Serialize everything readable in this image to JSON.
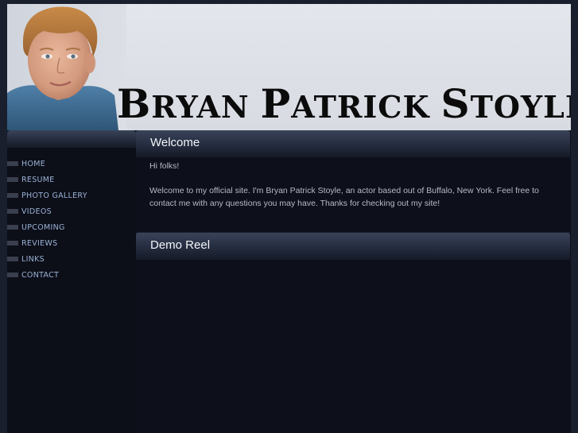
{
  "header": {
    "title_words": [
      {
        "cap": "B",
        "rest": "RYAN"
      },
      {
        "cap": "P",
        "rest": "ATRICK"
      },
      {
        "cap": "S",
        "rest": "TOYLE"
      }
    ]
  },
  "sidebar": {
    "items": [
      {
        "label": "HOME"
      },
      {
        "label": "RESUME"
      },
      {
        "label": "PHOTO GALLERY"
      },
      {
        "label": "VIDEOS"
      },
      {
        "label": "UPCOMING"
      },
      {
        "label": "REVIEWS"
      },
      {
        "label": "LINKS"
      },
      {
        "label": "CONTACT"
      }
    ]
  },
  "welcome": {
    "heading": "Welcome",
    "greeting": "Hi folks!",
    "body": "Welcome to my official site. I'm Bryan Patrick Stoyle, an actor based out of Buffalo, New York. Feel free to contact me with any questions you may have. Thanks for checking out my site!"
  },
  "demo_reel": {
    "heading": "Demo Reel"
  },
  "colors": {
    "background": "#0d0f1a",
    "nav_text": "#9ab3d6",
    "heading_text": "#f2f4f8",
    "body_text": "#b7bcc8",
    "header_bg": "#dcdfe6"
  }
}
